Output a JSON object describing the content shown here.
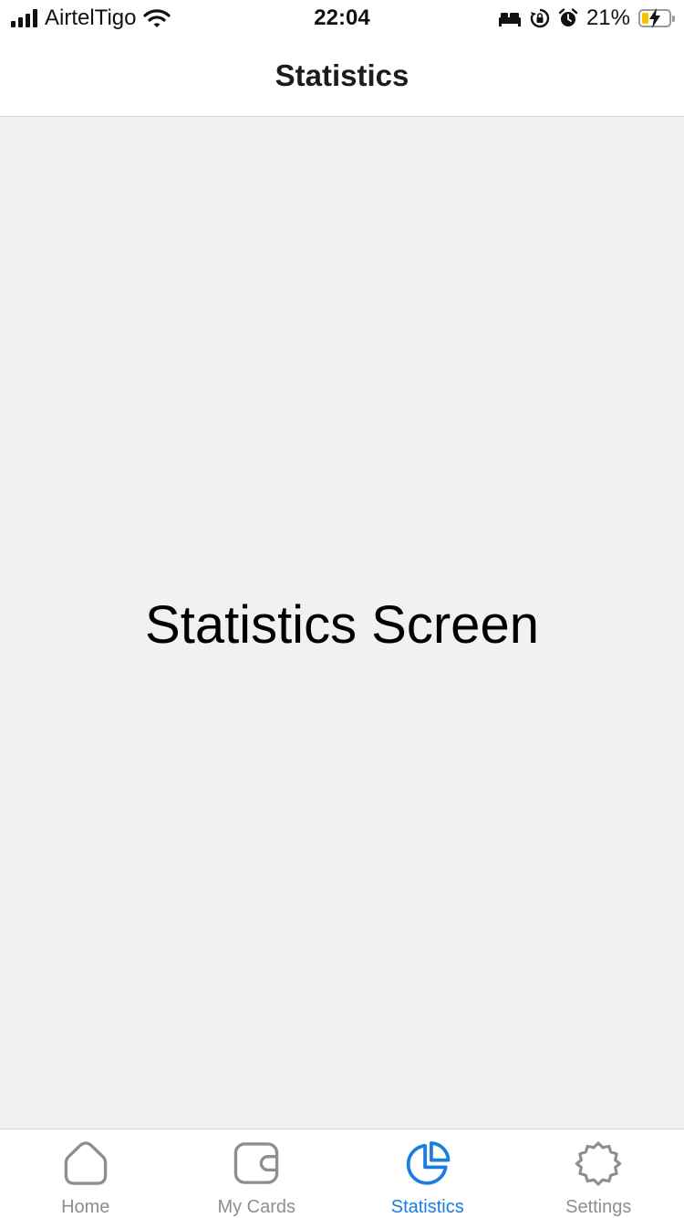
{
  "status_bar": {
    "carrier": "AirtelTigo",
    "time": "22:04",
    "battery_percent": "21%",
    "battery_level": 0.21,
    "icons": [
      "signal-icon",
      "wifi-icon",
      "bed-icon",
      "orientation-lock-icon",
      "alarm-icon",
      "battery-charging-icon"
    ]
  },
  "nav": {
    "title": "Statistics"
  },
  "main": {
    "label": "Statistics Screen"
  },
  "tab_bar": {
    "active_index": 2,
    "active_color": "#1a7de0",
    "inactive_color": "#8e8e8e",
    "tabs": [
      {
        "label": "Home",
        "icon": "home-icon"
      },
      {
        "label": "My Cards",
        "icon": "wallet-icon"
      },
      {
        "label": "Statistics",
        "icon": "pie-chart-icon"
      },
      {
        "label": "Settings",
        "icon": "gear-icon"
      }
    ]
  }
}
